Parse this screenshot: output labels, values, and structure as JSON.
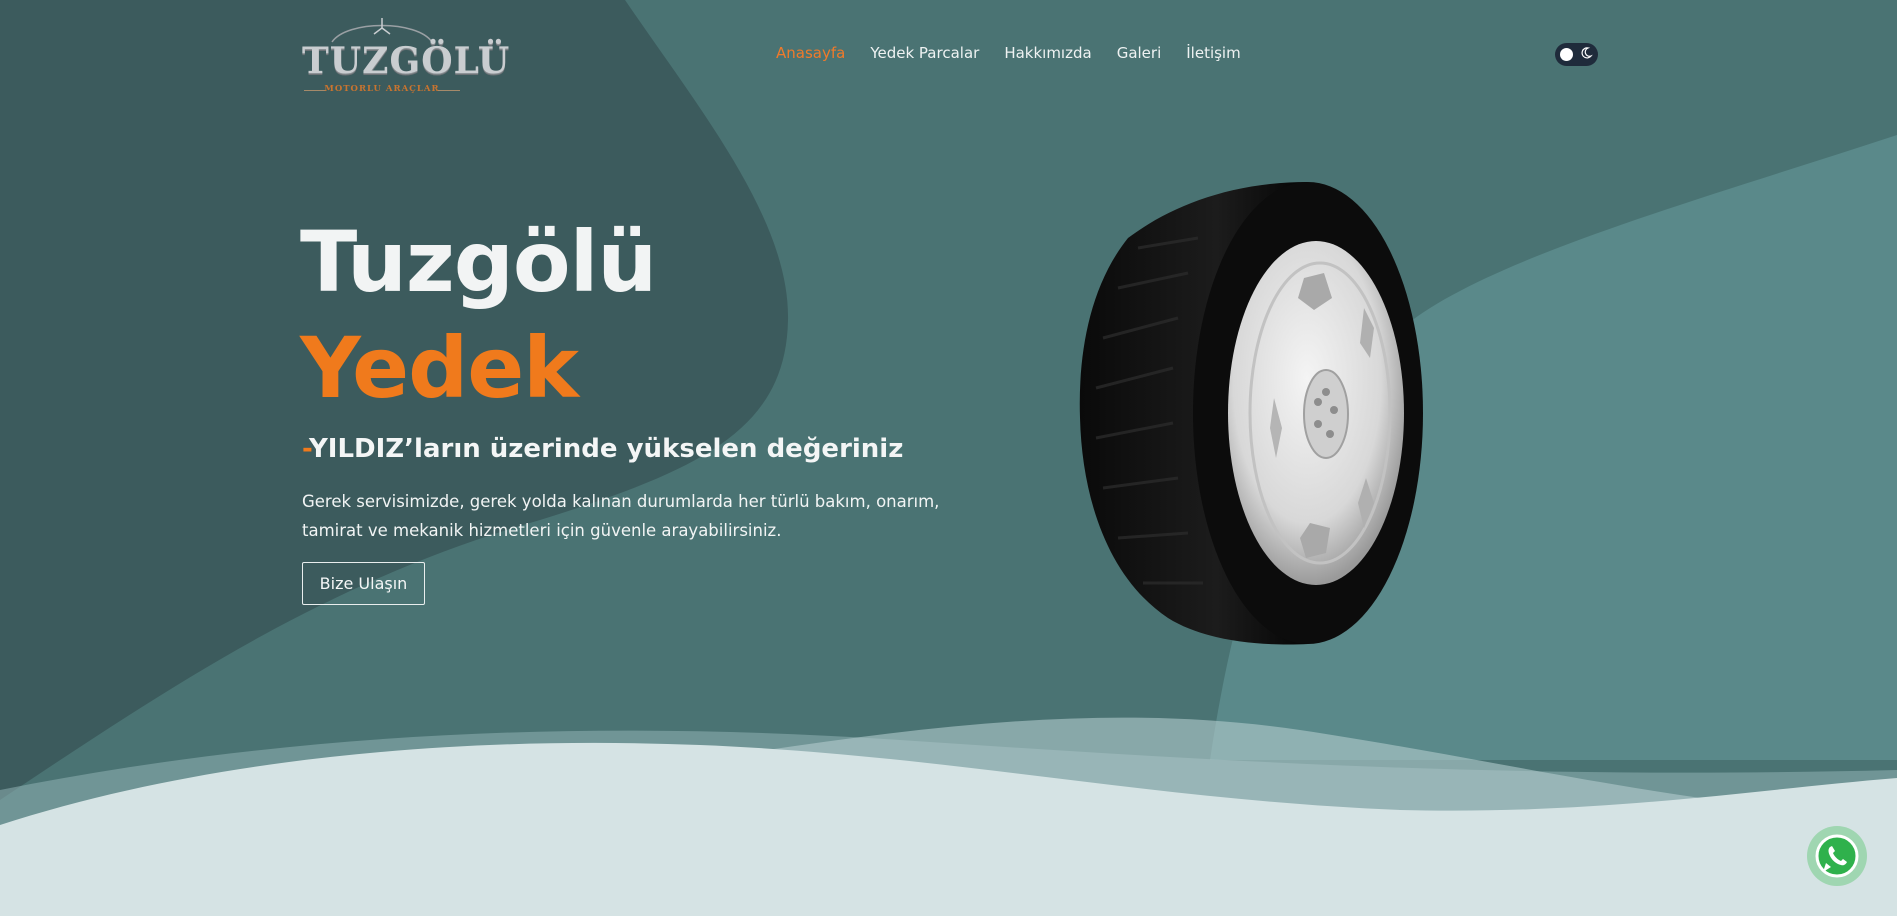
{
  "brand": {
    "logo_text": "TUZGÖLÜ",
    "logo_subtitle": "MOTORLU ARAÇLAR"
  },
  "nav": {
    "items": [
      {
        "label": "Anasayfa",
        "active": true
      },
      {
        "label": "Yedek Parcalar",
        "active": false
      },
      {
        "label": "Hakkımızda",
        "active": false
      },
      {
        "label": "Galeri",
        "active": false
      },
      {
        "label": "İletişim",
        "active": false
      }
    ]
  },
  "theme_toggle": {
    "icons": [
      "sun-knob",
      "moon-icon"
    ]
  },
  "hero": {
    "title_line1": "Tuzgölü",
    "title_line2": "Yedek",
    "tagline_dash": "-",
    "tagline": "YILDIZ’ların üzerinde yükselen değeriniz",
    "description": "Gerek servisimizde, gerek yolda kalınan durumlarda her türlü bakım, onarım, tamirat ve mekanik hizmetleri için güvenle arayabilirsiniz.",
    "cta_label": "Bize Ulaşın"
  },
  "whatsapp": {
    "icon": "whatsapp-icon"
  },
  "colors": {
    "accent": "#f07a1c",
    "background_dark": "#3c5b5d",
    "background_mid": "#4a7373",
    "background_light": "#5a8a8b",
    "wave": "#d5e3e4"
  }
}
